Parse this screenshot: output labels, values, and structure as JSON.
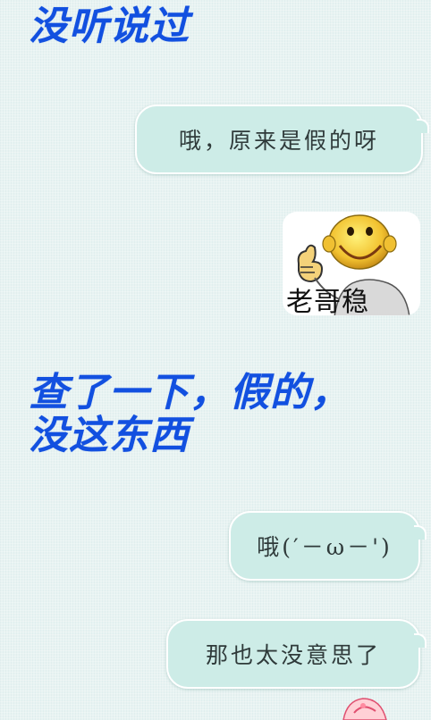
{
  "messages": {
    "incoming_1": "没听说过",
    "outgoing_1": "哦，原来是假的呀",
    "sticker_caption": "老哥稳",
    "incoming_2_line1": "查了一下，假的，",
    "incoming_2_line2": "没这东西",
    "outgoing_2": "哦(′－ω－')",
    "outgoing_3": "那也太没意思了"
  },
  "colors": {
    "incoming_text": "#1250e0",
    "bubble_fill": "#cdece7",
    "background": "#e8f3f2"
  },
  "icons": {
    "sticker": "thumbs-up-smiley-sticker",
    "partial": "partial-avatar-icon"
  }
}
